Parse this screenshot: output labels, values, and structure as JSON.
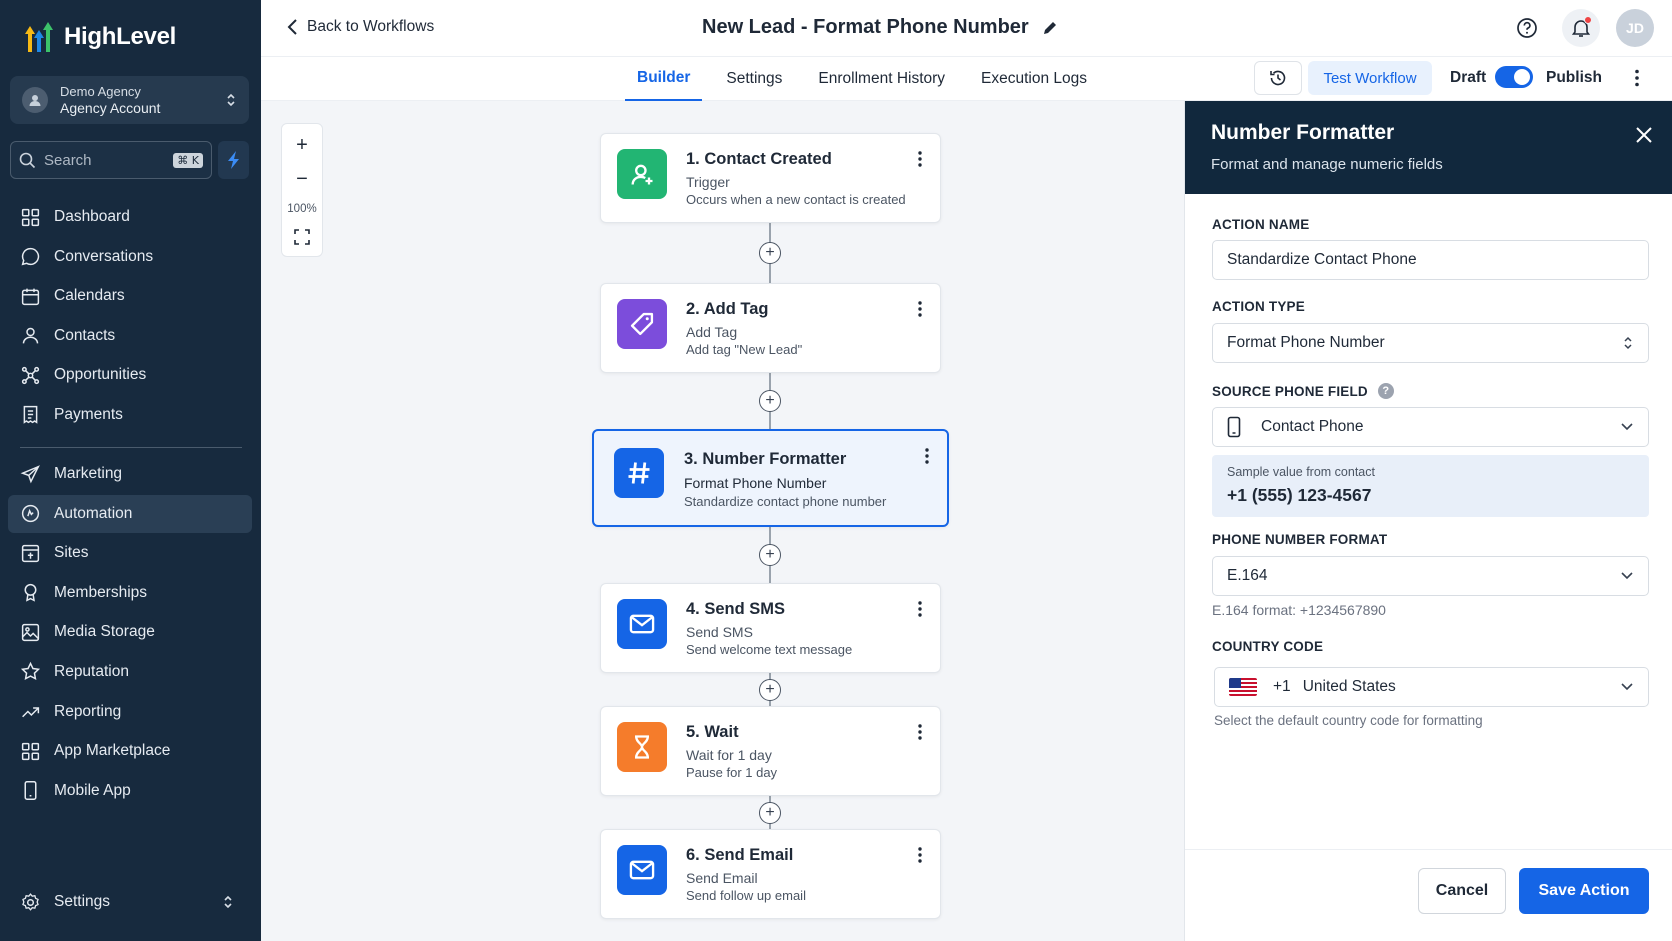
{
  "app": {
    "name": "HighLevel"
  },
  "account": {
    "line1": "Demo Agency",
    "line2": "Agency Account"
  },
  "search": {
    "placeholder": "Search",
    "shortcut": "⌘ K"
  },
  "nav": [
    {
      "label": "Dashboard",
      "icon": "grid-icon"
    },
    {
      "label": "Conversations",
      "icon": "chat-icon"
    },
    {
      "label": "Calendars",
      "icon": "calendar-icon"
    },
    {
      "label": "Contacts",
      "icon": "person-icon"
    },
    {
      "label": "Opportunities",
      "icon": "network-icon"
    },
    {
      "label": "Payments",
      "icon": "receipt-icon"
    },
    {
      "label": "Marketing",
      "icon": "send-icon"
    },
    {
      "label": "Automation",
      "icon": "automation-icon",
      "active": true
    },
    {
      "label": "Sites",
      "icon": "sites-icon"
    },
    {
      "label": "Memberships",
      "icon": "badge-icon"
    },
    {
      "label": "Media Storage",
      "icon": "image-icon"
    },
    {
      "label": "Reputation",
      "icon": "star-icon"
    },
    {
      "label": "Reporting",
      "icon": "trend-icon"
    },
    {
      "label": "App Marketplace",
      "icon": "apps-icon"
    },
    {
      "label": "Mobile App",
      "icon": "phone-icon"
    }
  ],
  "settings_label": "Settings",
  "header": {
    "back": "Back to Workflows",
    "title": "New Lead - Format Phone Number",
    "avatar": "JD"
  },
  "tabs": [
    "Builder",
    "Settings",
    "Enrollment History",
    "Execution Logs"
  ],
  "toolbar": {
    "test": "Test Workflow",
    "draft": "Draft",
    "publish": "Publish"
  },
  "zoom": {
    "level": "100%"
  },
  "steps": [
    {
      "title": "1. Contact Created",
      "sub": "Trigger",
      "desc": "Occurs when a new contact is created",
      "color": "#22b573",
      "icon": "person-add-icon"
    },
    {
      "title": "2. Add Tag",
      "sub": "Add Tag",
      "desc": "Add tag \"New Lead\"",
      "color": "#7c4ddb",
      "icon": "tag-icon"
    },
    {
      "title": "3. Number Formatter",
      "sub": "Format Phone Number",
      "desc": "Standardize contact phone number",
      "color": "#1565e6",
      "icon": "hash-icon"
    },
    {
      "title": "4. Send SMS",
      "sub": "Send SMS",
      "desc": "Send welcome text message",
      "color": "#1565e6",
      "icon": "mail-icon"
    },
    {
      "title": "5. Wait",
      "sub": "Wait for 1 day",
      "desc": "Pause for 1 day",
      "color": "#f57c2b",
      "icon": "hourglass-icon"
    },
    {
      "title": "6. Send Email",
      "sub": "Send Email",
      "desc": "Send follow up email",
      "color": "#1565e6",
      "icon": "mail-icon"
    }
  ],
  "panel": {
    "title": "Number Formatter",
    "subtitle": "Format and manage numeric fields",
    "action_name_label": "ACTION NAME",
    "action_name_value": "Standardize Contact Phone",
    "action_type_label": "ACTION TYPE",
    "action_type_value": "Format Phone Number",
    "source_label": "SOURCE PHONE FIELD",
    "source_value": "Contact Phone",
    "sample_label": "Sample value from contact",
    "sample_value": "+1 (555) 123-4567",
    "format_label": "PHONE NUMBER FORMAT",
    "format_value": "E.164",
    "format_hint": "E.164 format: +1234567890",
    "country_label": "COUNTRY CODE",
    "country_code": "+1",
    "country_name": "United States",
    "country_hint": "Select the default country code for formatting",
    "cancel": "Cancel",
    "save": "Save Action"
  }
}
